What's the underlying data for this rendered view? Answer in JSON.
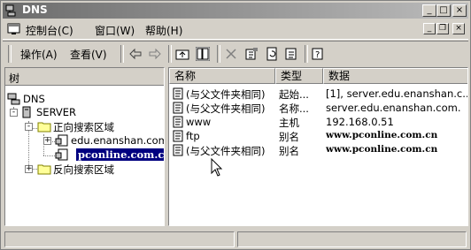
{
  "window": {
    "title": "DNS"
  },
  "title_buttons": {
    "minimize": "_",
    "maximize": "□",
    "close": "×"
  },
  "menu": {
    "items": [
      {
        "label": "操作(A)"
      },
      {
        "label": "控制台(C)"
      },
      {
        "label": "窗口(W)"
      },
      {
        "label": "帮助(H)"
      }
    ],
    "console_label": "控制台(C)",
    "window_label": "窗口(W)",
    "help_label": "帮助(H)"
  },
  "toolbar": {
    "action_label": "操作(A)",
    "view_label": "查看(V)"
  },
  "tree": {
    "header": "树",
    "root": "DNS",
    "server": "SERVER",
    "forward_zone": "正向搜索区域",
    "zone1": "edu.enanshan.com",
    "zone2": "pconline.com.cn",
    "reverse_zone": "反向搜索区域"
  },
  "list": {
    "columns": {
      "name": "名称",
      "type": "类型",
      "data": "数据"
    },
    "rows": [
      {
        "name": "(与父文件夹相同)",
        "type": "起始...",
        "data": "[1], server.edu.enanshan.c..."
      },
      {
        "name": "(与父文件夹相同)",
        "type": "名称...",
        "data": "server.edu.enanshan.com."
      },
      {
        "name": "www",
        "type": "主机",
        "data": "192.168.0.51"
      },
      {
        "name": "ftp",
        "type": "别名",
        "data": "www.pconline.com.cn"
      },
      {
        "name": "(与父文件夹相同)",
        "type": "别名",
        "data": "www.pconline.com.cn"
      }
    ]
  },
  "colors": {
    "selection": "#000080",
    "face": "#d4d0c8",
    "titlebar": "#6c6c6c"
  }
}
